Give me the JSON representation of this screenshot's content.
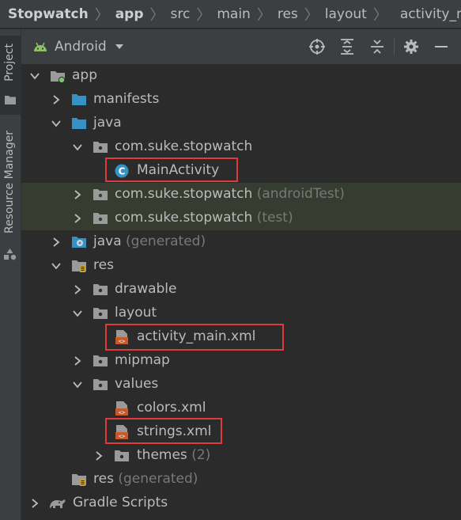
{
  "breadcrumb": [
    "Stopwatch",
    "app",
    "src",
    "main",
    "res",
    "layout",
    "activity_main.x"
  ],
  "sidebar": {
    "project_tab": "Project",
    "resource_tab": "Resource Manager"
  },
  "toolwindow": {
    "view_mode": "Android",
    "icons": [
      "locate-icon",
      "expand-all-icon",
      "collapse-all-icon",
      "gear-icon",
      "minimize-icon"
    ]
  },
  "tree": [
    {
      "name": "app",
      "suffix": "",
      "depth": 0,
      "expanded": true,
      "icon": "module-folder-icon"
    },
    {
      "name": "manifests",
      "suffix": "",
      "depth": 1,
      "expanded": false,
      "icon": "folder-icon"
    },
    {
      "name": "java",
      "suffix": "",
      "depth": 1,
      "expanded": true,
      "icon": "folder-icon"
    },
    {
      "name": "com.suke.stopwatch",
      "suffix": "",
      "depth": 2,
      "expanded": true,
      "icon": "package-icon"
    },
    {
      "name": "MainActivity",
      "suffix": "",
      "depth": 3,
      "expanded": null,
      "icon": "class-icon",
      "highlighted_box": true
    },
    {
      "name": "com.suke.stopwatch",
      "suffix": "(androidTest)",
      "depth": 2,
      "expanded": false,
      "icon": "package-icon"
    },
    {
      "name": "com.suke.stopwatch",
      "suffix": "(test)",
      "depth": 2,
      "expanded": false,
      "icon": "package-icon"
    },
    {
      "name": "java",
      "suffix": "(generated)",
      "depth": 1,
      "expanded": false,
      "icon": "generated-folder-icon"
    },
    {
      "name": "res",
      "suffix": "",
      "depth": 1,
      "expanded": true,
      "icon": "res-folder-icon"
    },
    {
      "name": "drawable",
      "suffix": "",
      "depth": 2,
      "expanded": false,
      "icon": "package-icon"
    },
    {
      "name": "layout",
      "suffix": "",
      "depth": 2,
      "expanded": true,
      "icon": "package-icon"
    },
    {
      "name": "activity_main.xml",
      "suffix": "",
      "depth": 3,
      "expanded": null,
      "icon": "xml-file-icon",
      "highlighted_box": true
    },
    {
      "name": "mipmap",
      "suffix": "",
      "depth": 2,
      "expanded": false,
      "icon": "package-icon"
    },
    {
      "name": "values",
      "suffix": "",
      "depth": 2,
      "expanded": true,
      "icon": "package-icon"
    },
    {
      "name": "colors.xml",
      "suffix": "",
      "depth": 3,
      "expanded": null,
      "icon": "xml-file-icon"
    },
    {
      "name": "strings.xml",
      "suffix": "",
      "depth": 3,
      "expanded": null,
      "icon": "xml-file-icon",
      "highlighted_box": true
    },
    {
      "name": "themes",
      "suffix": "(2)",
      "depth": 3,
      "expanded": false,
      "icon": "package-icon"
    },
    {
      "name": "res",
      "suffix": "(generated)",
      "depth": 1,
      "expanded": null,
      "icon": "res-folder-icon"
    },
    {
      "name": "Gradle Scripts",
      "suffix": "",
      "depth": 0,
      "expanded": false,
      "icon": "gradle-icon"
    }
  ],
  "colors": {
    "background": "#2b2b2b",
    "panel": "#3c3f41",
    "row_highlight": "#363d30",
    "callout_box": "#e03b3b",
    "folder_blue": "#3592c4",
    "android_green": "#8cc265"
  }
}
